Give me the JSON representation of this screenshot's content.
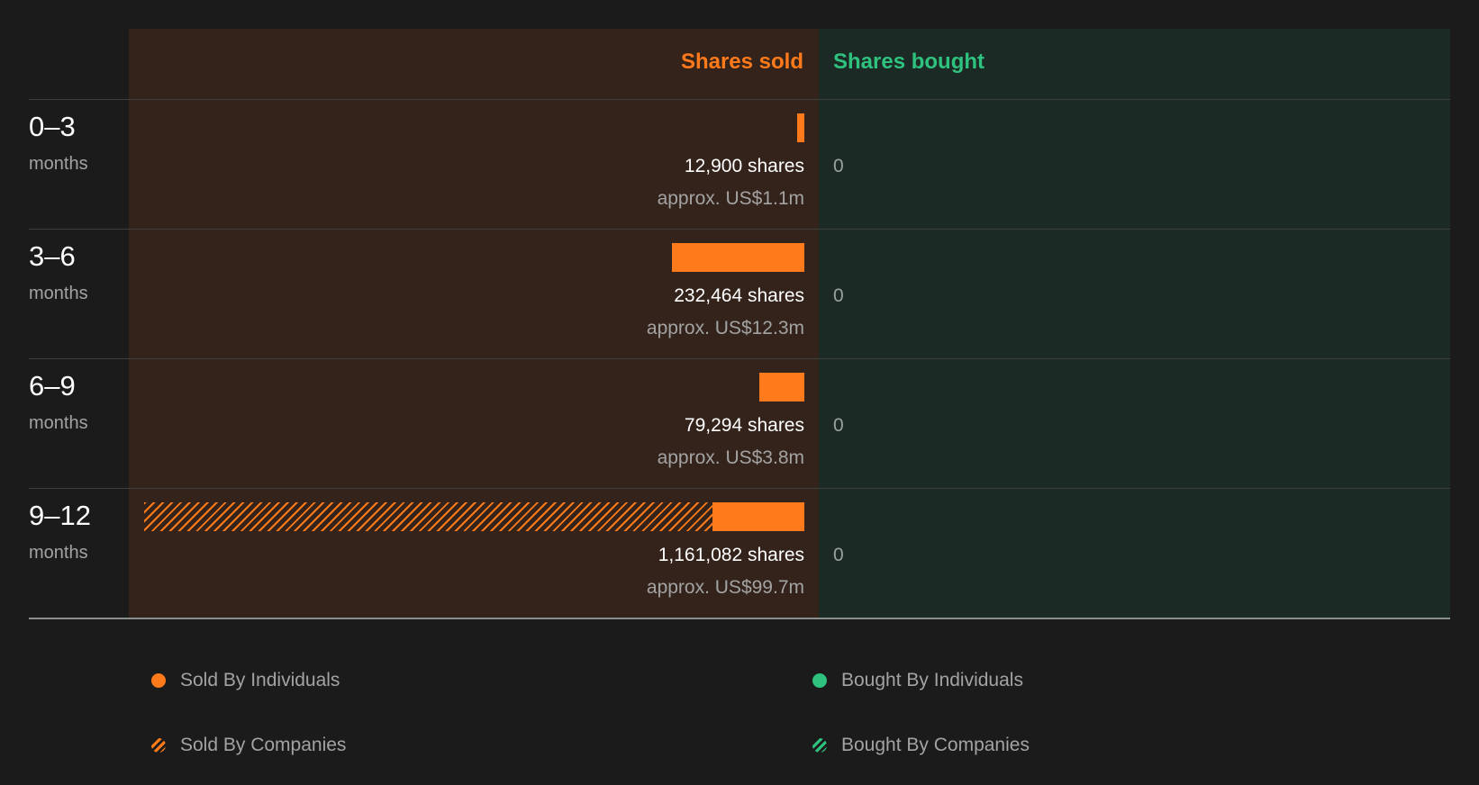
{
  "chart_data": {
    "type": "bar",
    "title": "",
    "xlabel": "",
    "ylabel": "",
    "column_headers": {
      "sold": "Shares sold",
      "bought": "Shares bought"
    },
    "categories": [
      {
        "range": "0–3",
        "unit": "months"
      },
      {
        "range": "3–6",
        "unit": "months"
      },
      {
        "range": "6–9",
        "unit": "months"
      },
      {
        "range": "9–12",
        "unit": "months"
      }
    ],
    "series": [
      {
        "name": "Sold By Individuals",
        "values": [
          12900,
          232464,
          79294,
          161082
        ]
      },
      {
        "name": "Sold By Companies",
        "values": [
          0,
          0,
          0,
          1000000
        ]
      },
      {
        "name": "Bought By Individuals",
        "values": [
          0,
          0,
          0,
          0
        ]
      },
      {
        "name": "Bought By Companies",
        "values": [
          0,
          0,
          0,
          0
        ]
      }
    ],
    "sold_shares_labels": [
      "12,900 shares",
      "232,464 shares",
      "79,294 shares",
      "1,161,082 shares"
    ],
    "sold_value_labels": [
      "approx. US$1.1m",
      "approx. US$12.3m",
      "approx. US$3.8m",
      "approx. US$99.7m"
    ],
    "bought_labels": [
      "0",
      "0",
      "0",
      "0"
    ],
    "xlim": [
      0,
      1161082
    ],
    "legend_placement": "bottom",
    "grid": false,
    "colors": {
      "sold": "#ff7a1a",
      "bought": "#2ec27e"
    }
  }
}
